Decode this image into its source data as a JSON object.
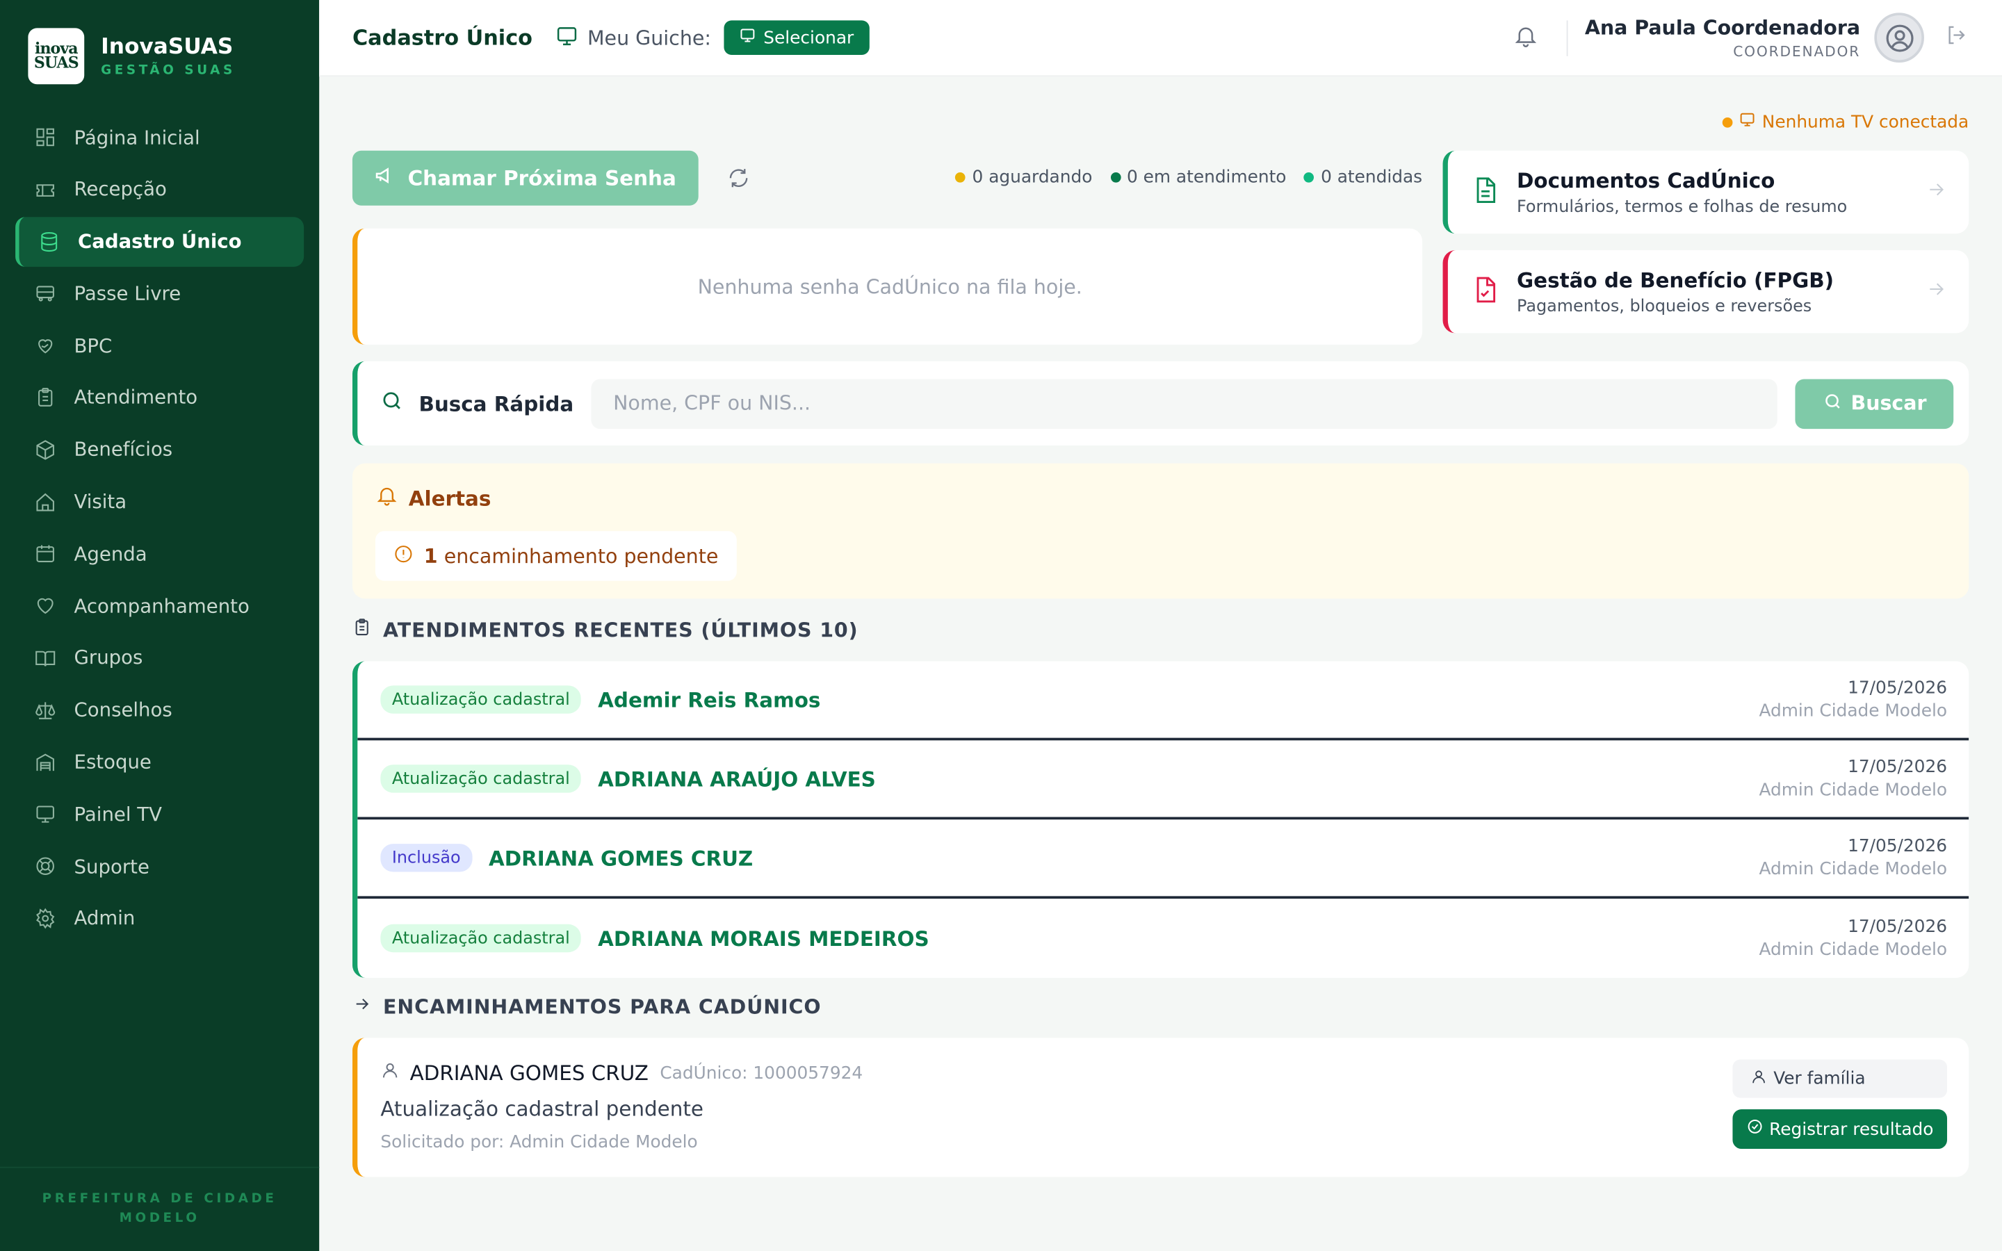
{
  "brand": {
    "logo_text": "inova SUAS",
    "name": "InovaSUAS",
    "subtitle": "GESTÃO SUAS"
  },
  "sidebar": {
    "items": [
      {
        "label": "Página Inicial",
        "icon": "grid-icon"
      },
      {
        "label": "Recepção",
        "icon": "ticket-icon"
      },
      {
        "label": "Cadastro Único",
        "icon": "database-icon",
        "active": true
      },
      {
        "label": "Passe Livre",
        "icon": "bus-icon"
      },
      {
        "label": "BPC",
        "icon": "hand-heart-icon"
      },
      {
        "label": "Atendimento",
        "icon": "clipboard-icon"
      },
      {
        "label": "Benefícios",
        "icon": "package-icon"
      },
      {
        "label": "Visita",
        "icon": "home-icon"
      },
      {
        "label": "Agenda",
        "icon": "calendar-icon"
      },
      {
        "label": "Acompanhamento",
        "icon": "heart-icon"
      },
      {
        "label": "Grupos",
        "icon": "book-icon"
      },
      {
        "label": "Conselhos",
        "icon": "scale-icon"
      },
      {
        "label": "Estoque",
        "icon": "warehouse-icon"
      },
      {
        "label": "Painel TV",
        "icon": "monitor-icon"
      },
      {
        "label": "Suporte",
        "icon": "lifebuoy-icon"
      },
      {
        "label": "Admin",
        "icon": "gear-icon"
      }
    ],
    "footer": "PREFEITURA DE CIDADE MODELO"
  },
  "header": {
    "title": "Cadastro Único",
    "guiche_label": "Meu Guiche:",
    "select_label": "Selecionar",
    "user_name": "Ana Paula Coordenadora",
    "user_role": "COORDENADOR"
  },
  "tv_status": "Nenhuma TV conectada",
  "queue": {
    "call_label": "Chamar Próxima Senha",
    "waiting": "0 aguardando",
    "in_service": "0 em atendimento",
    "served": "0 atendidas",
    "empty_message": "Nenhuma senha CadÚnico na fila hoje."
  },
  "quick_cards": [
    {
      "title": "Documentos CadÚnico",
      "subtitle": "Formulários, termos e folhas de resumo"
    },
    {
      "title": "Gestão de Benefício (FPGB)",
      "subtitle": "Pagamentos, bloqueios e reversões"
    }
  ],
  "search": {
    "label": "Busca Rápida",
    "placeholder": "Nome, CPF ou NIS...",
    "button": "Buscar"
  },
  "alerts": {
    "title": "Alertas",
    "count": "1",
    "text": "encaminhamento pendente"
  },
  "recent": {
    "title": "ATENDIMENTOS RECENTES (ÚLTIMOS 10)",
    "rows": [
      {
        "tag": "Atualização cadastral",
        "name": "Ademir Reis Ramos",
        "date": "17/05/2026",
        "by": "Admin Cidade Modelo"
      },
      {
        "tag": "Atualização cadastral",
        "name": "ADRIANA ARAÚJO ALVES",
        "date": "17/05/2026",
        "by": "Admin Cidade Modelo"
      },
      {
        "tag": "Inclusão",
        "name": "ADRIANA GOMES CRUZ",
        "date": "17/05/2026",
        "by": "Admin Cidade Modelo"
      },
      {
        "tag": "Atualização cadastral",
        "name": "ADRIANA MORAIS MEDEIROS",
        "date": "17/05/2026",
        "by": "Admin Cidade Modelo"
      }
    ]
  },
  "referrals": {
    "title": "ENCAMINHAMENTOS PARA CADÚNICO",
    "item": {
      "name": "ADRIANA GOMES CRUZ",
      "cadunico": "CadÚnico: 1000057924",
      "description": "Atualização cadastral pendente",
      "requested_by": "Solicitado por: Admin Cidade Modelo",
      "view_family": "Ver família",
      "register": "Registrar resultado"
    }
  },
  "colors": {
    "sidebar_bg": "#0a3d27",
    "accent": "#087a4b",
    "warning": "#f59e0b",
    "danger": "#e11d48"
  }
}
